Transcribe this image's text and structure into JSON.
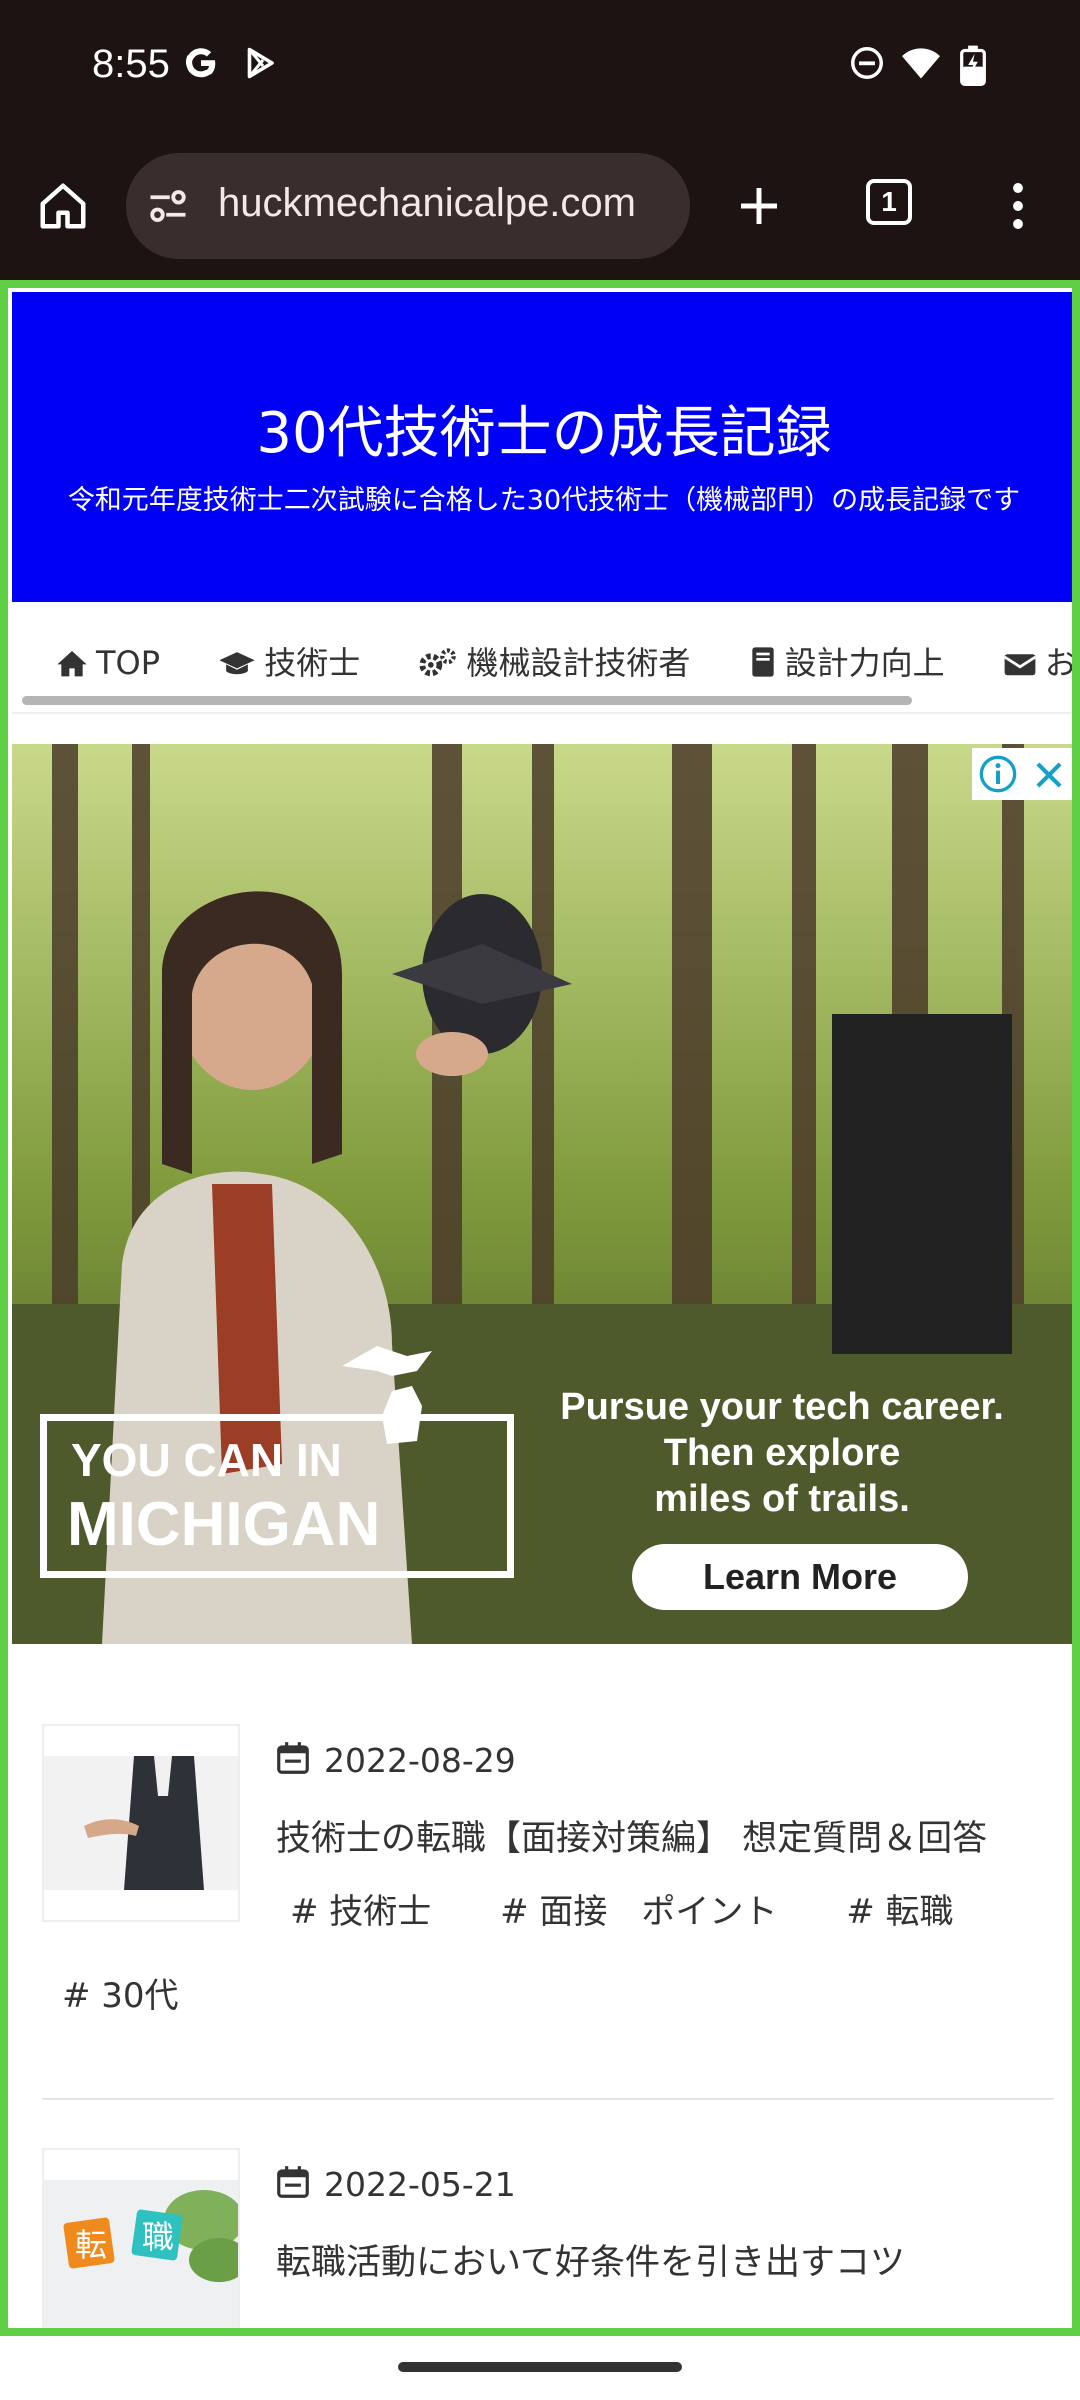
{
  "status_bar": {
    "time": "8:55",
    "icons": [
      "google-icon",
      "play-store-icon",
      "do-not-disturb-icon",
      "wifi-icon",
      "battery-charging-icon"
    ]
  },
  "browser": {
    "url": "huckmechanicalpe.com",
    "tab_count": "1",
    "icons": [
      "home-icon",
      "site-settings-icon",
      "new-tab-icon",
      "tab-switcher-icon",
      "menu-icon"
    ]
  },
  "site": {
    "title": "30代技術士の成長記録",
    "subtitle": "令和元年度技術士二次試験に合格した30代技術士（機械部門）の成長記録です",
    "header_color": "#0000f5"
  },
  "nav": {
    "items": [
      "TOP",
      "技術士",
      "機械設計技術者",
      "設計力向上",
      "お問い"
    ]
  },
  "ad": {
    "badge_line1": "YOU CAN IN",
    "badge_line2": "MICHIGAN",
    "copy": [
      "Pursue your tech career.",
      "Then explore",
      "miles of trails."
    ],
    "cta": "Learn More"
  },
  "posts": [
    {
      "date": "2022-08-29",
      "title": "技術士の転職【面接対策編】 想定質問＆回答",
      "tags": [
        "# 技術士",
        "# 面接　ポイント",
        "# 転職"
      ],
      "tags_row2": [
        "# 30代"
      ]
    },
    {
      "date": "2022-05-21",
      "title": "転職活動において好条件を引き出すコツ",
      "thumb_chars": [
        "転",
        "職"
      ]
    }
  ],
  "accent_colors": {
    "frame": "#5fcf45",
    "ad_info": "#14a0c8"
  }
}
